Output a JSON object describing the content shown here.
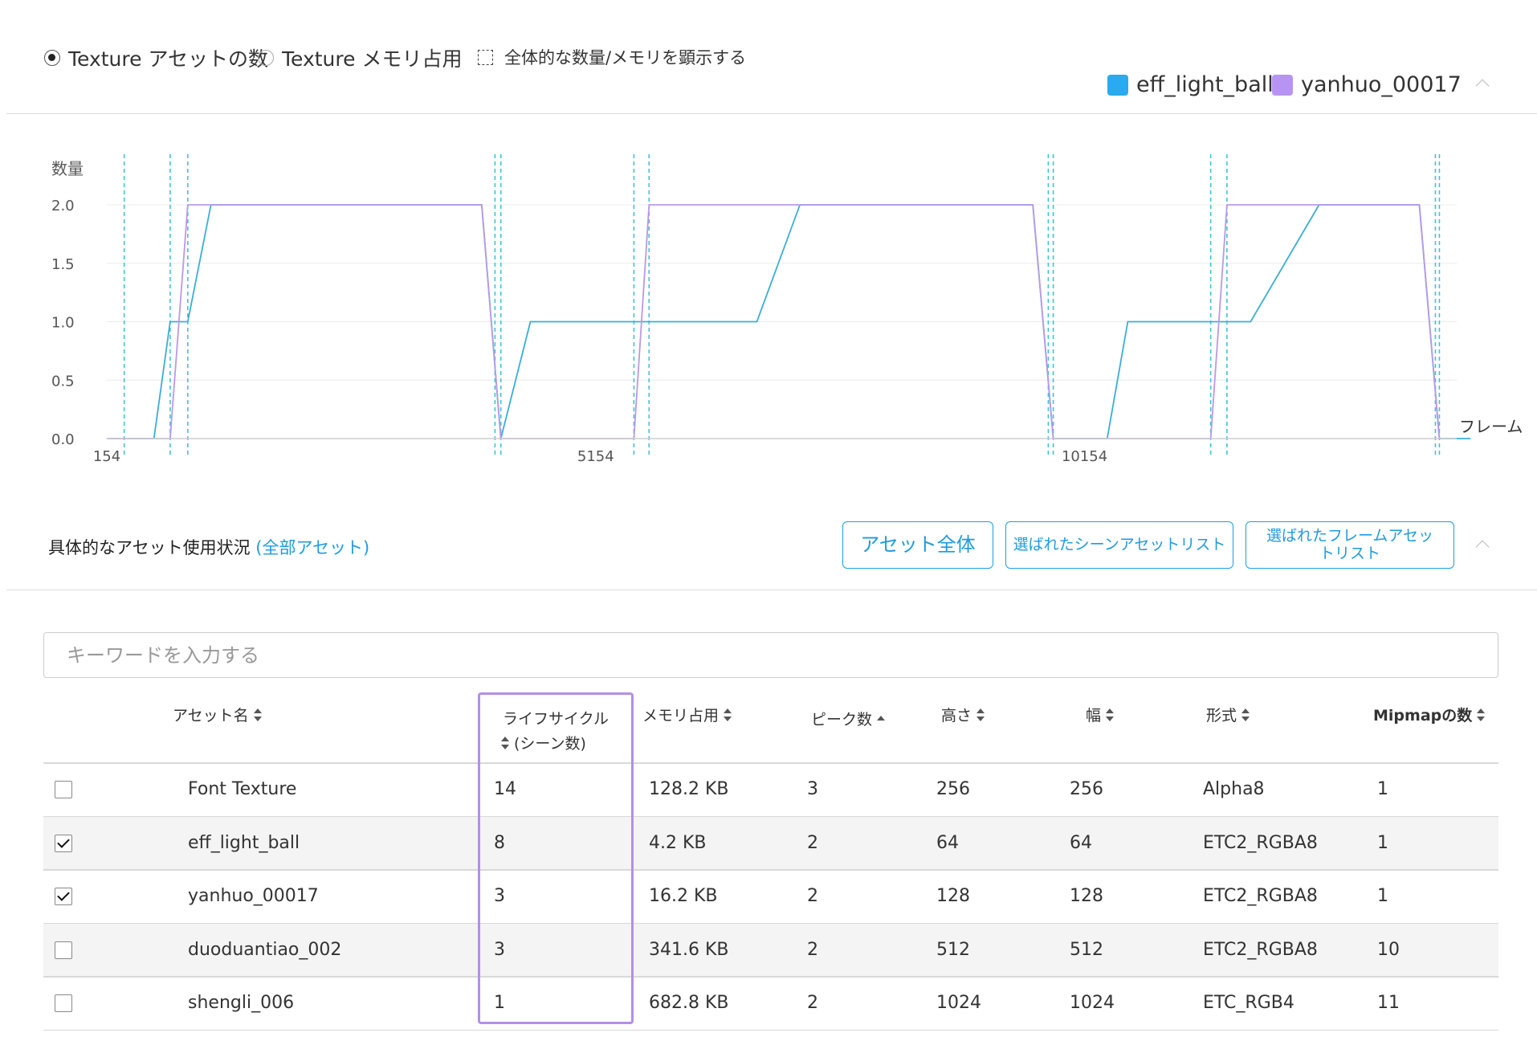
{
  "controls": {
    "radio_count": "Texture アセットの数",
    "radio_memory": "Texture メモリ占用",
    "checkbox_total": "全体的な数量/メモリを顕示する"
  },
  "legend": [
    {
      "name": "eff_light_ball",
      "color": "#2aaaf0"
    },
    {
      "name": "yanhuo_00017",
      "color": "#b794f4"
    }
  ],
  "chart_data": {
    "type": "line",
    "ylabel": "数量",
    "xlabel": "フレーム",
    "ylim": [
      0,
      2.0
    ],
    "yticks": [
      "2.0",
      "1.5",
      "1.0",
      "0.5",
      "0.0"
    ],
    "xticks": [
      {
        "label": "154",
        "frame": 154
      },
      {
        "label": "5154",
        "frame": 5154
      },
      {
        "label": "10154",
        "frame": 10154
      }
    ],
    "x_range": [
      154,
      13960
    ],
    "grid": true,
    "series": [
      {
        "name": "eff_light_ball",
        "color": "#3aaed8",
        "points": [
          [
            154,
            0
          ],
          [
            636,
            0
          ],
          [
            802,
            1
          ],
          [
            982,
            1
          ],
          [
            1219,
            2
          ],
          [
            3989,
            2
          ],
          [
            4184,
            0
          ],
          [
            4486,
            1
          ],
          [
            6802,
            1
          ],
          [
            7243,
            2
          ],
          [
            9625,
            2
          ],
          [
            9834,
            0
          ],
          [
            10386,
            0
          ],
          [
            10596,
            1
          ],
          [
            11852,
            1
          ],
          [
            12552,
            2
          ],
          [
            13578,
            2
          ],
          [
            13783,
            0
          ],
          [
            14102,
            0
          ]
        ]
      },
      {
        "name": "yanhuo_00017",
        "color": "#b999e9",
        "points": [
          [
            154,
            0
          ],
          [
            802,
            0
          ],
          [
            982,
            2
          ],
          [
            3989,
            2
          ],
          [
            4184,
            0
          ],
          [
            5545,
            0
          ],
          [
            5700,
            2
          ],
          [
            9625,
            2
          ],
          [
            9834,
            0
          ],
          [
            11444,
            0
          ],
          [
            11610,
            2
          ],
          [
            13578,
            2
          ],
          [
            13783,
            0
          ]
        ]
      }
    ],
    "markers_frames": [
      332,
      802,
      982,
      4124,
      4184,
      5545,
      5700,
      9783,
      9834,
      11444,
      11610,
      13742,
      13783
    ]
  },
  "usage": {
    "title": "具体的なアセット使用状況",
    "link": "(全部アセット)",
    "btn_all": "アセット全体",
    "btn_scene": "選ばれたシーンアセットリスト",
    "btn_frame": "選ばれたフレームアセットリスト"
  },
  "search": {
    "placeholder": "キーワードを入力する"
  },
  "table": {
    "headers": {
      "name": "アセット名",
      "lifecycle_1": "ライフサイクル",
      "lifecycle_2": "(シーン数)",
      "memory": "メモリ占用",
      "peak": "ピーク数",
      "height": "高さ",
      "width": "幅",
      "format": "形式",
      "mipmap": "Mipmapの数"
    },
    "rows": [
      {
        "checked": false,
        "name": "Font Texture",
        "lifecycle": "14",
        "memory": "128.2 KB",
        "peak": "3",
        "height": "256",
        "width": "256",
        "format": "Alpha8",
        "mipmap": "1"
      },
      {
        "checked": true,
        "name": "eff_light_ball",
        "lifecycle": "8",
        "memory": "4.2 KB",
        "peak": "2",
        "height": "64",
        "width": "64",
        "format": "ETC2_RGBA8",
        "mipmap": "1"
      },
      {
        "checked": true,
        "name": "yanhuo_00017",
        "lifecycle": "3",
        "memory": "16.2 KB",
        "peak": "2",
        "height": "128",
        "width": "128",
        "format": "ETC2_RGBA8",
        "mipmap": "1"
      },
      {
        "checked": false,
        "name": "duoduantiao_002",
        "lifecycle": "3",
        "memory": "341.6 KB",
        "peak": "2",
        "height": "512",
        "width": "512",
        "format": "ETC2_RGBA8",
        "mipmap": "10"
      },
      {
        "checked": false,
        "name": "shengli_006",
        "lifecycle": "1",
        "memory": "682.8 KB",
        "peak": "2",
        "height": "1024",
        "width": "1024",
        "format": "ETC_RGB4",
        "mipmap": "11"
      }
    ]
  }
}
